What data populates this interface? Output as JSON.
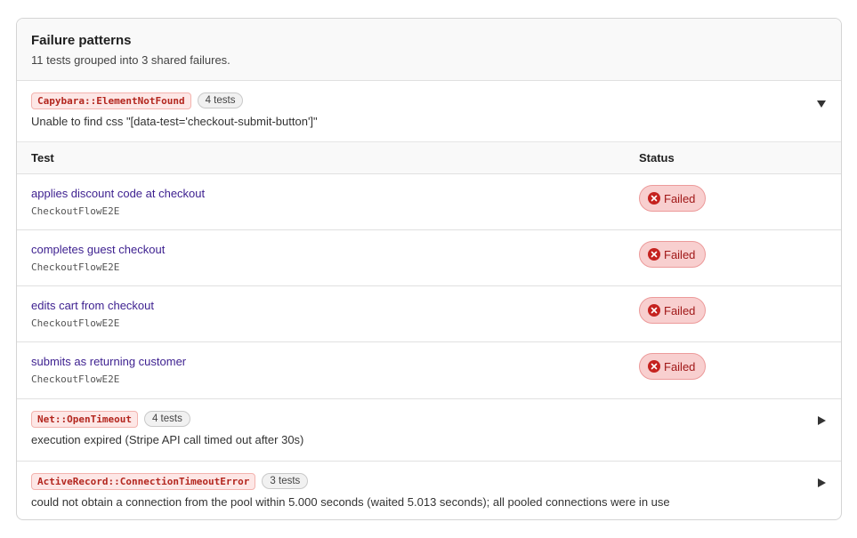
{
  "header": {
    "title": "Failure patterns",
    "subtitle": "11 tests grouped into 3 shared failures."
  },
  "groups": [
    {
      "error": "Capybara::ElementNotFound",
      "count": "4 tests",
      "message": "Unable to find css \"[data-test='checkout-submit-button']\"",
      "expanded": true,
      "columns": {
        "test": "Test",
        "status": "Status"
      },
      "rows": [
        {
          "name": "applies discount code at checkout",
          "class": "CheckoutFlowE2E",
          "status": "Failed"
        },
        {
          "name": "completes guest checkout",
          "class": "CheckoutFlowE2E",
          "status": "Failed"
        },
        {
          "name": "edits cart from checkout",
          "class": "CheckoutFlowE2E",
          "status": "Failed"
        },
        {
          "name": "submits as returning customer",
          "class": "CheckoutFlowE2E",
          "status": "Failed"
        }
      ]
    },
    {
      "error": "Net::OpenTimeout",
      "count": "4 tests",
      "message": "execution expired (Stripe API call timed out after 30s)",
      "expanded": false
    },
    {
      "error": "ActiveRecord::ConnectionTimeoutError",
      "count": "3 tests",
      "message": "could not obtain a connection from the pool within 5.000 seconds (waited 5.013 seconds); all pooled connections were in use",
      "expanded": false
    }
  ],
  "icons": {
    "expanded": "triangle-down-icon",
    "collapsed": "triangle-right-icon",
    "failed": "x-circle-icon"
  },
  "colors": {
    "error_tag_text": "#b3261e",
    "error_tag_bg": "#fde7e6",
    "failed_badge_bg": "#f8cfcf",
    "failed_text": "#a01818",
    "link": "#3c1f8f"
  }
}
